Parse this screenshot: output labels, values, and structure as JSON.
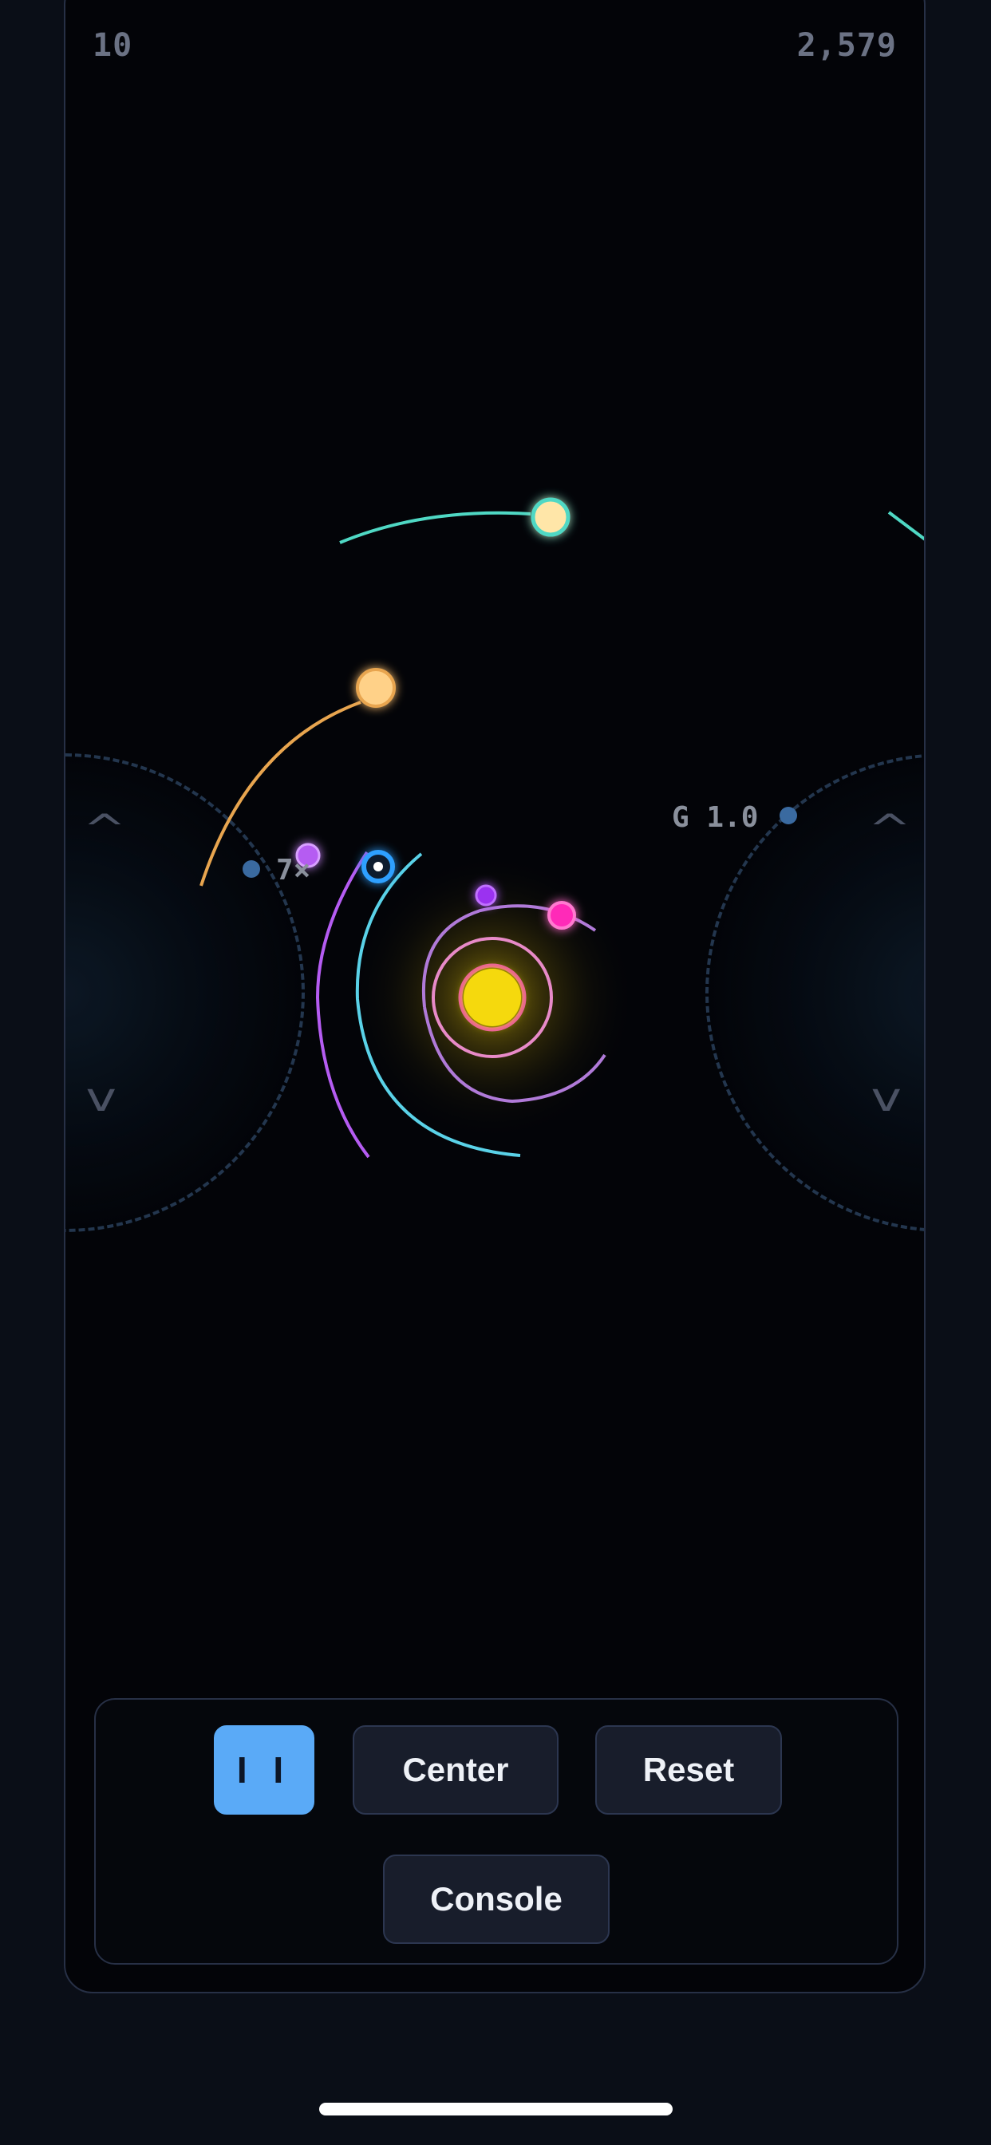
{
  "hud": {
    "left_counter": "10",
    "right_counter": "2,579"
  },
  "labels": {
    "speed": "7×",
    "gravity": "G 1.0"
  },
  "joysticks": {
    "left": {
      "up_glyph": "^",
      "down_glyph": "v"
    },
    "right": {
      "up_glyph": "^",
      "down_glyph": "v"
    }
  },
  "controls": {
    "pause_label": "I I",
    "center_label": "Center",
    "reset_label": "Reset",
    "console_label": "Console"
  },
  "colors": {
    "background": "#030408",
    "panel_border": "#273046",
    "accent_blue": "#5aaaf7",
    "sun": "#f5d90a",
    "teal": "#4fd8c4",
    "orange": "#e8a54f",
    "purple": "#b55cf2",
    "magenta": "#ff2bb8",
    "pink": "#f08ac8",
    "cyan_blue": "#2fa0ff"
  }
}
